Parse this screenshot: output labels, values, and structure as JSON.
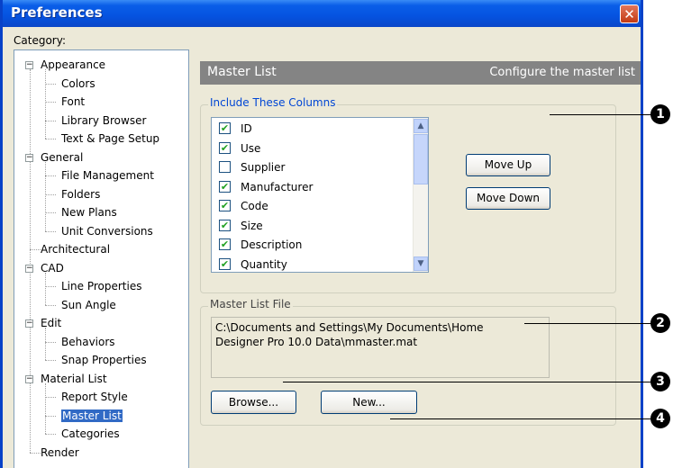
{
  "window": {
    "title": "Preferences",
    "close_glyph": "✕"
  },
  "category_label": "Category:",
  "tree": {
    "groups": [
      {
        "label": "Appearance",
        "children": [
          "Colors",
          "Font",
          "Library Browser",
          "Text & Page Setup"
        ]
      },
      {
        "label": "General",
        "children": [
          "File Management",
          "Folders",
          "New Plans",
          "Unit Conversions"
        ]
      },
      {
        "label": "Architectural",
        "children": []
      },
      {
        "label": "CAD",
        "children": [
          "Line Properties",
          "Sun Angle"
        ]
      },
      {
        "label": "Edit",
        "children": [
          "Behaviors",
          "Snap Properties"
        ]
      },
      {
        "label": "Material List",
        "children": [
          "Report Style",
          "Master List",
          "Categories"
        ]
      },
      {
        "label": "Render",
        "children": []
      }
    ],
    "selected": "Master List"
  },
  "header": {
    "title": "Master List",
    "description": "Configure the master list"
  },
  "columns_group": {
    "legend": "Include These Columns",
    "items": [
      {
        "label": "ID",
        "checked": true
      },
      {
        "label": "Use",
        "checked": true
      },
      {
        "label": "Supplier",
        "checked": false
      },
      {
        "label": "Manufacturer",
        "checked": true
      },
      {
        "label": "Code",
        "checked": true
      },
      {
        "label": "Size",
        "checked": true
      },
      {
        "label": "Description",
        "checked": true
      },
      {
        "label": "Quantity",
        "checked": true
      }
    ],
    "move_up": "Move Up",
    "move_down": "Move Down"
  },
  "file_group": {
    "legend": "Master List File",
    "path_line1": "C:\\Documents and Settings\\My Documents\\Home",
    "path_line2": "Designer Pro 10.0 Data\\mmaster.mat",
    "browse": "Browse...",
    "new": "New..."
  },
  "callouts": [
    "1",
    "2",
    "3",
    "4"
  ],
  "icons": {
    "scroll_up": "chevron-up-icon",
    "scroll_down": "chevron-down-icon",
    "close": "close-icon",
    "check": "checkmark-icon"
  }
}
